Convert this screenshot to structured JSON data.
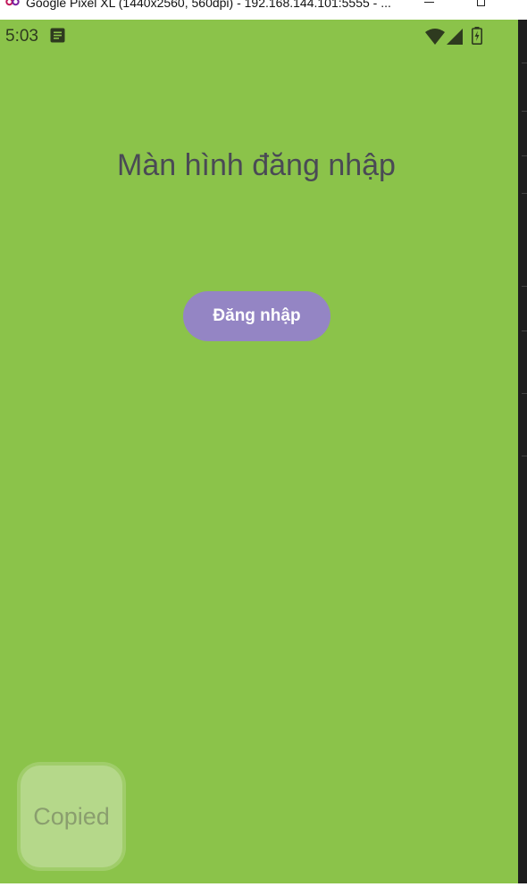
{
  "window": {
    "title": "Google Pixel XL (1440x2560, 560dpi) - 192.168.144.101:5555 - ...",
    "app_icon": "emulator-icon",
    "minimize_icon": "minimize-icon",
    "maximize_icon": "maximize-icon"
  },
  "status_bar": {
    "time": "5:03",
    "notification_icon": "notes-icon",
    "wifi_icon": "wifi-icon",
    "signal_icon": "signal-icon",
    "battery_icon": "battery-charging-icon"
  },
  "screen": {
    "background": "#8bc34a",
    "heading": "Màn hình đăng nhập",
    "login_button_label": "Đăng nhập",
    "login_button_color": "#9485c4"
  },
  "toast": {
    "text": "Copied"
  }
}
